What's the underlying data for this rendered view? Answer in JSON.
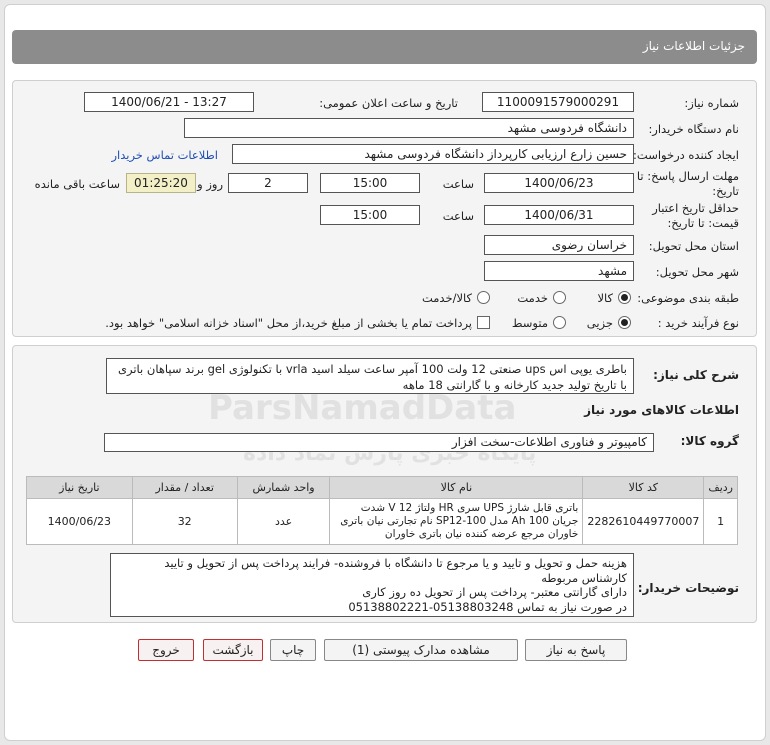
{
  "page_title": "جزئیات اطلاعات نیاز",
  "fields": {
    "need_number_label": "شماره نیاز:",
    "need_number": "1100091579000291",
    "announce_label": "تاریخ و ساعت اعلان عمومی:",
    "announce_value": "1400/06/21 - 13:27",
    "buyer_org_label": "نام دستگاه خریدار:",
    "buyer_org": "دانشگاه فردوسی مشهد",
    "creator_label": "ایجاد کننده درخواست:",
    "creator": "حسین زارع ارزیابی کارپرداز دانشگاه فردوسی مشهد",
    "contact_link": "اطلاعات تماس خریدار",
    "reply_deadline_label_1": "مهلت ارسال پاسخ: تا",
    "reply_deadline_label_2": "تاریخ:",
    "reply_date": "1400/06/23",
    "time_label": "ساعت",
    "reply_time": "15:00",
    "days_value": "2",
    "days_label": "روز و",
    "timer": "01:25:20",
    "remaining_label": "ساعت باقی مانده",
    "validity_label_1": "حداقل تاریخ اعتبار",
    "validity_label_2": "قیمت: تا تاریخ:",
    "validity_date": "1400/06/31",
    "validity_time_label": "ساعت",
    "validity_time": "15:00",
    "delivery_province_label": "استان محل تحویل:",
    "delivery_province": "خراسان رضوی",
    "delivery_city_label": "شهر محل تحویل:",
    "delivery_city": "مشهد",
    "category_label": "طبقه بندی موضوعی:",
    "category_options": [
      "کالا",
      "خدمت",
      "کالا/خدمت"
    ],
    "process_label": "نوع فرآیند خرید :",
    "process_options": [
      "جزیی",
      "متوسط"
    ],
    "treasury_note": "پرداخت تمام یا بخشی از مبلغ خرید،از محل \"اسناد خزانه اسلامی\" خواهد بود."
  },
  "summary": {
    "label": "شرح کلی نیاز:",
    "text": "باطری یوپی اس ups صنعتی 12 ولت 100 آمپر ساعت سیلد اسید vrla با تکنولوژی gel برند سپاهان باتری با تاریخ تولید جدید کارخانه و با گارانتی 18 ماهه"
  },
  "goods_section_title": "اطلاعات کالاهای مورد نیاز",
  "goods_group": {
    "label": "گروه کالا:",
    "value": "کامپیوتر و فناوری اطلاعات-سخت افزار"
  },
  "table": {
    "headers": [
      "ردیف",
      "کد کالا",
      "نام کالا",
      "واحد شمارش",
      "تعداد / مقدار",
      "تاریخ نیاز"
    ],
    "rows": [
      {
        "row": "1",
        "code": "2282610449770007",
        "name": "باتری قابل شارژ UPS سری HR ولتاژ 12 V شدت جریان 100 Ah مدل SP12-100 نام تجارتی نیان باتری خاوران مرجع عرضه کننده نیان باتری خاوران",
        "unit": "عدد",
        "qty": "32",
        "date": "1400/06/23"
      }
    ]
  },
  "buyer_notes": {
    "label": "توضیحات خریدار:",
    "lines": [
      "هزینه حمل و تحویل و تایید و یا مرجوع تا دانشگاه با فروشنده- فرایند پرداخت پس از تحویل و تایید کارشناس مربوطه",
      "دارای گارانتی معتبر- پرداخت پس از تحویل ده روز کاری",
      "در صورت نیاز به تماس 05138803248-05138802221"
    ]
  },
  "buttons": {
    "reply": "پاسخ به نیاز",
    "attachments": "مشاهده مدارک پیوستی (1)",
    "print": "چاپ",
    "back": "بازگشت",
    "exit": "خروج"
  },
  "colors": {
    "title_bar": "#8c8c8c",
    "link": "#1f4fb4",
    "timer_bg": "#f3f0c8",
    "red_button_border": "#c03030"
  }
}
